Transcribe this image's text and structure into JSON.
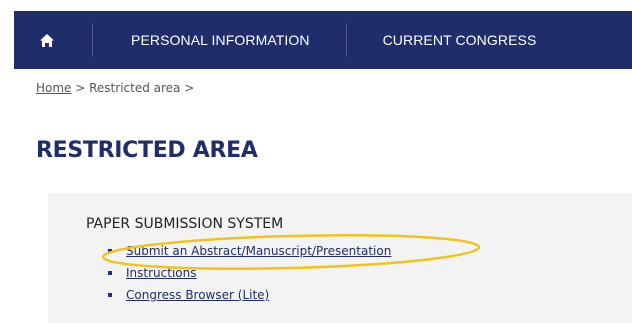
{
  "nav": {
    "home_icon": "home-icon",
    "items": [
      {
        "label": "PERSONAL INFORMATION"
      },
      {
        "label": "CURRENT CONGRESS"
      }
    ]
  },
  "breadcrumb": {
    "home": "Home",
    "sep1": " > ",
    "current": "Restricted area",
    "sep2": " >"
  },
  "page_title": "RESTRICTED AREA",
  "section": {
    "heading": "PAPER SUBMISSION SYSTEM",
    "links": [
      {
        "label": "Submit an Abstract/Manuscript/Presentation"
      },
      {
        "label": "Instructions"
      },
      {
        "label": "Congress Browser (Lite)"
      }
    ]
  },
  "colors": {
    "nav_bg": "#1f2d6a",
    "title": "#1f2d6a",
    "highlight": "#f2c31a"
  }
}
